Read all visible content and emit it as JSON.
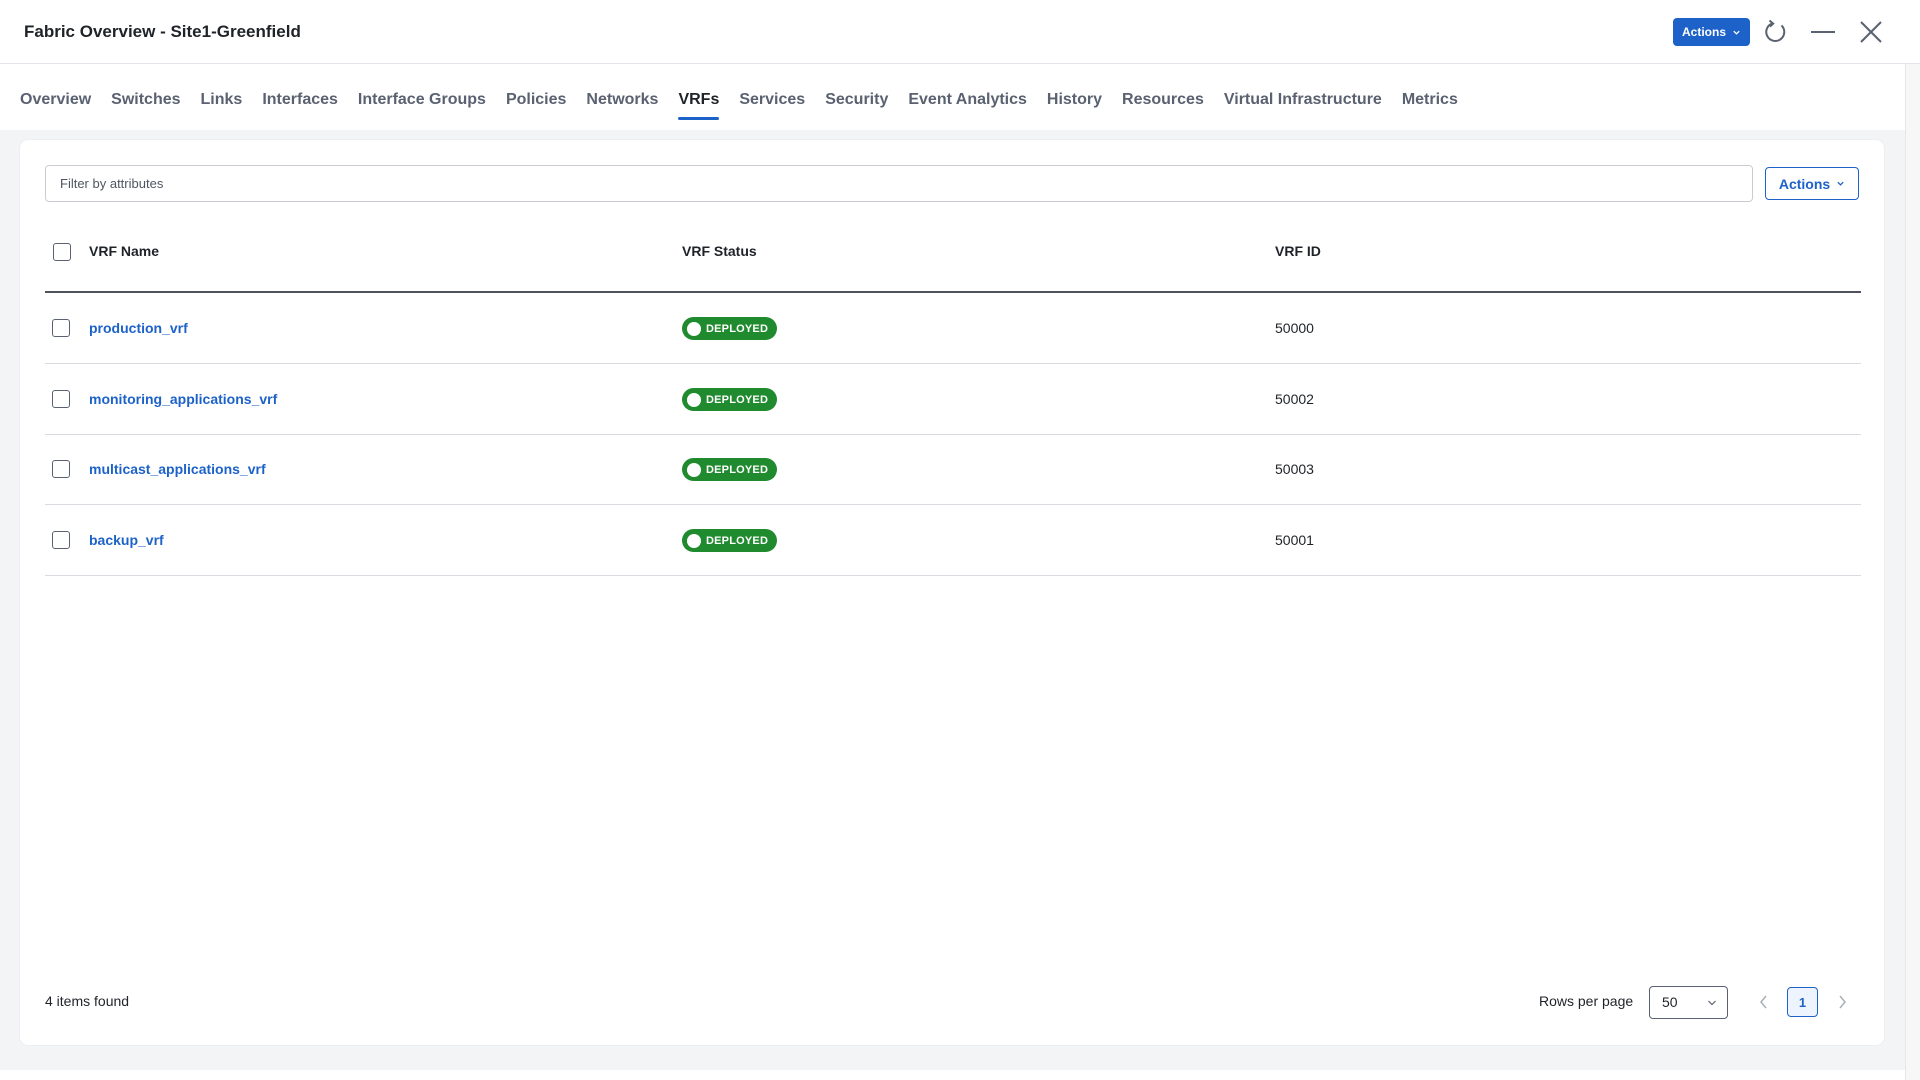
{
  "window": {
    "title": "Fabric Overview - Site1-Greenfield",
    "actions_label": "Actions"
  },
  "tabs": [
    {
      "label": "Overview",
      "active": false
    },
    {
      "label": "Switches",
      "active": false
    },
    {
      "label": "Links",
      "active": false
    },
    {
      "label": "Interfaces",
      "active": false
    },
    {
      "label": "Interface Groups",
      "active": false
    },
    {
      "label": "Policies",
      "active": false
    },
    {
      "label": "Networks",
      "active": false
    },
    {
      "label": "VRFs",
      "active": true
    },
    {
      "label": "Services",
      "active": false
    },
    {
      "label": "Security",
      "active": false
    },
    {
      "label": "Event Analytics",
      "active": false
    },
    {
      "label": "History",
      "active": false
    },
    {
      "label": "Resources",
      "active": false
    },
    {
      "label": "Virtual Infrastructure",
      "active": false
    },
    {
      "label": "Metrics",
      "active": false
    }
  ],
  "table": {
    "filter_placeholder": "Filter by attributes",
    "actions_label": "Actions",
    "columns": [
      "VRF Name",
      "VRF Status",
      "VRF ID"
    ],
    "rows": [
      {
        "name": "production_vrf",
        "status": "DEPLOYED",
        "id": "50000"
      },
      {
        "name": "monitoring_applications_vrf",
        "status": "DEPLOYED",
        "id": "50002"
      },
      {
        "name": "multicast_applications_vrf",
        "status": "DEPLOYED",
        "id": "50003"
      },
      {
        "name": "backup_vrf",
        "status": "DEPLOYED",
        "id": "50001"
      }
    ]
  },
  "footer": {
    "items_found": "4 items found",
    "rows_per_page_label": "Rows per page",
    "rows_per_page_value": "50",
    "current_page": "1"
  },
  "colors": {
    "accent": "#1d62c9",
    "status_deployed": "#1f8a2e"
  },
  "icons": [
    "chevron-down-icon",
    "refresh-icon",
    "minimize-icon",
    "close-icon",
    "chevron-left-icon",
    "chevron-right-icon"
  ]
}
